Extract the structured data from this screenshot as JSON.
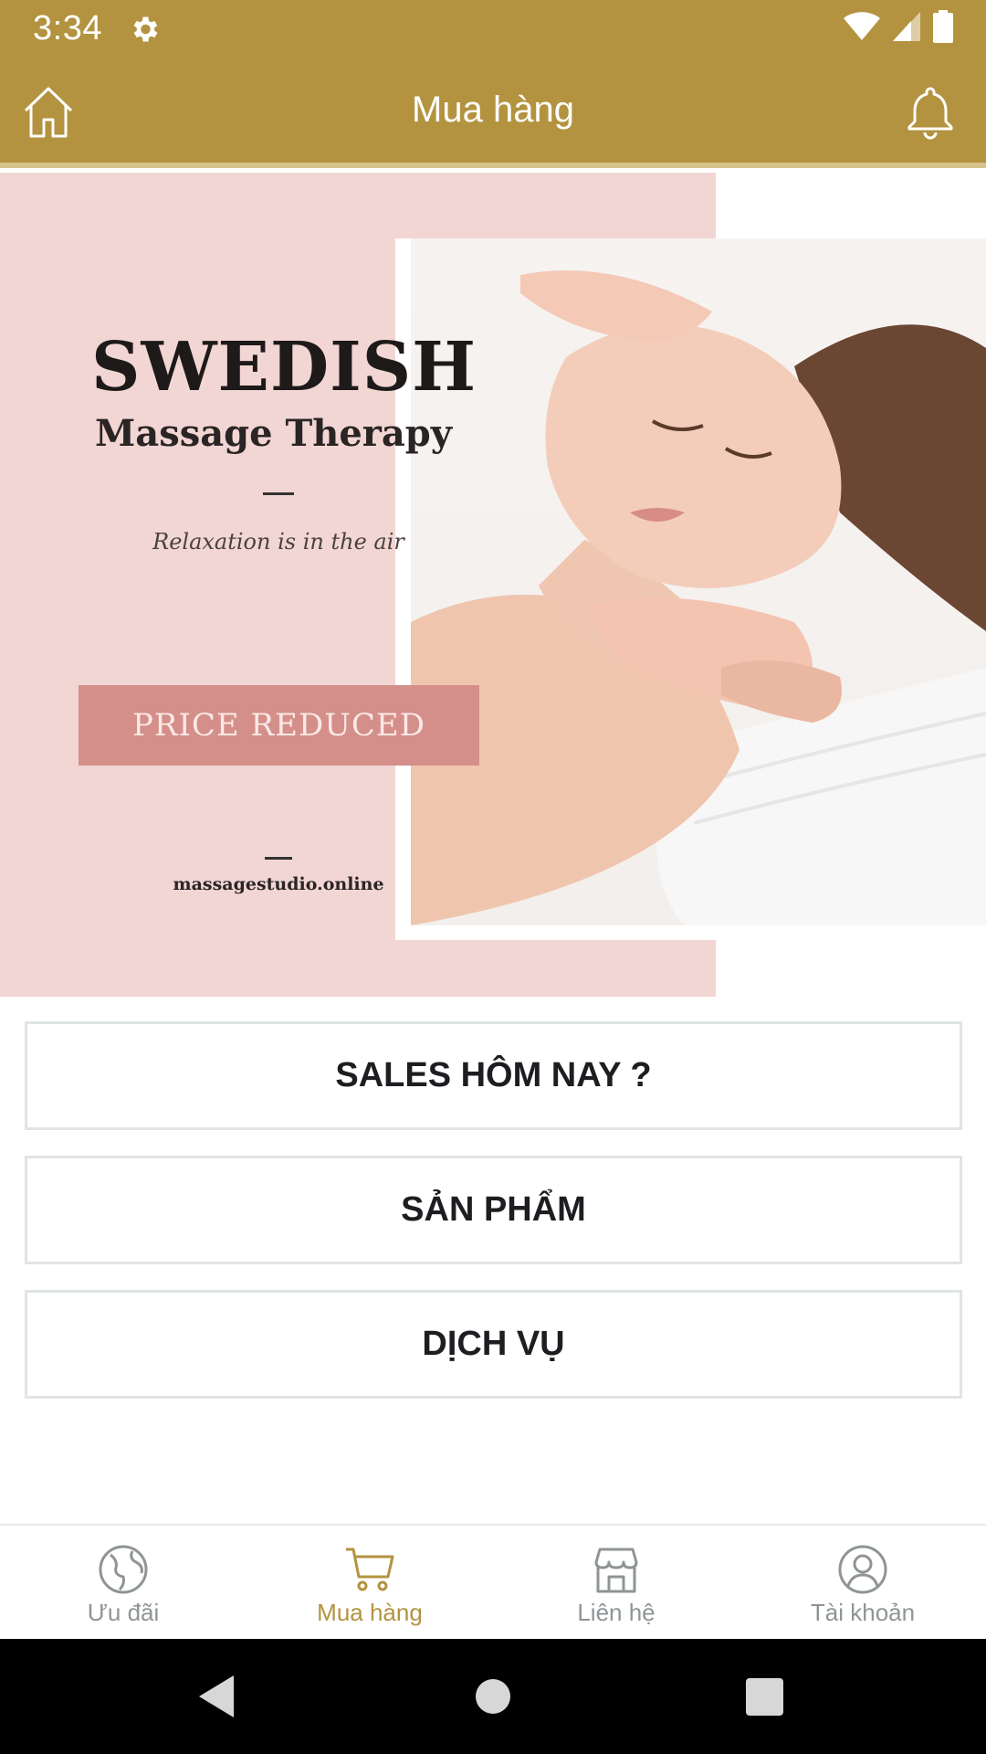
{
  "status_bar": {
    "time": "3:34",
    "icons": [
      "gear-icon",
      "wifi-icon",
      "signal-icon",
      "battery-icon"
    ]
  },
  "app_bar": {
    "title": "Mua hàng",
    "left_icon": "home-icon",
    "right_icon": "bell-icon"
  },
  "banner": {
    "title": "SWEDISH",
    "subtitle": "Massage Therapy",
    "tagline": "Relaxation is in the air",
    "badge": "PRICE REDUCED",
    "website": "massagestudio.online"
  },
  "menu": {
    "sales_label": "SALES HÔM NAY ?",
    "products_label": "SẢN PHẨM",
    "services_label": "DỊCH VỤ"
  },
  "bottom_nav": {
    "items": [
      {
        "label": "Ưu đãi",
        "icon": "globe-icon",
        "active": false
      },
      {
        "label": "Mua hàng",
        "icon": "cart-icon",
        "active": true
      },
      {
        "label": "Liên hệ",
        "icon": "store-icon",
        "active": false
      },
      {
        "label": "Tài khoản",
        "icon": "user-icon",
        "active": false
      }
    ]
  },
  "colors": {
    "brand": "#b3933f",
    "banner_pink": "#f2d6d3",
    "badge": "#d48f8b",
    "nav_inactive": "#8f9496"
  }
}
